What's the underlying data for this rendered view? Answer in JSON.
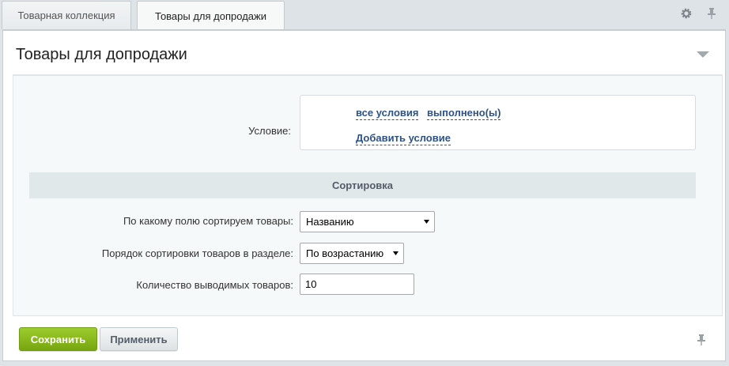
{
  "tabs": [
    {
      "label": "Товарная коллекция",
      "active": false
    },
    {
      "label": "Товары для допродажи",
      "active": true
    }
  ],
  "panel": {
    "title": "Товары для допродажи"
  },
  "condition": {
    "label": "Условие:",
    "all_conditions_link": "все условия",
    "fulfilled_link": "выполнено(ы)",
    "add_condition_link": "Добавить условие"
  },
  "sorting": {
    "section_title": "Сортировка",
    "sort_field_label": "По какому полю сортируем товары:",
    "sort_field_value": "Названию",
    "sort_order_label": "Порядок сортировки товаров в разделе:",
    "sort_order_value": "По возрастанию",
    "count_label": "Количество выводимых товаров:",
    "count_value": "10"
  },
  "buttons": {
    "save": "Сохранить",
    "apply": "Применить"
  },
  "icons": {
    "settings": "gear-icon",
    "pin": "pin-icon",
    "collapse": "triangle-down-icon"
  },
  "colors": {
    "save_button": "#8cbc1e",
    "link": "#2d5288",
    "section_bg": "#e0e8ea"
  }
}
